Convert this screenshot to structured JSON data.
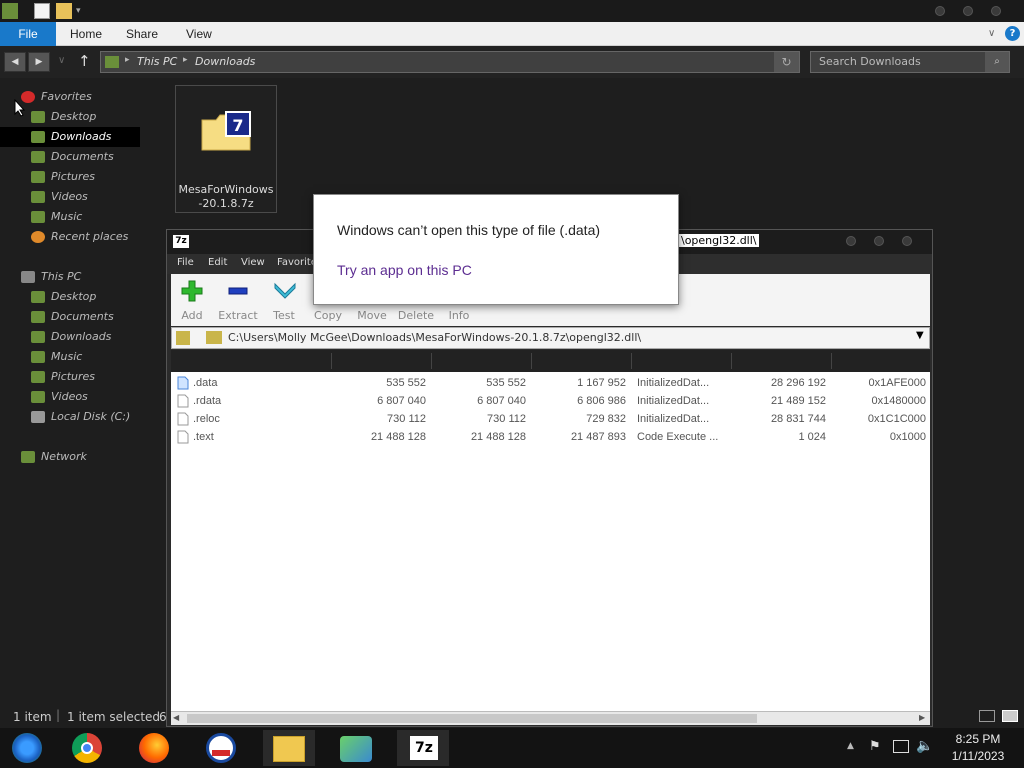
{
  "ribbon": {
    "file": "File",
    "home": "Home",
    "share": "Share",
    "view": "View"
  },
  "address": {
    "crumbs": [
      "This PC",
      "Downloads"
    ]
  },
  "search": {
    "placeholder": "Search Downloads"
  },
  "nav": {
    "favorites": "Favorites",
    "fav_items": [
      "Desktop",
      "Downloads",
      "Documents",
      "Pictures",
      "Videos",
      "Music",
      "Recent places"
    ],
    "this_pc": "This PC",
    "pc_items": [
      "Desktop",
      "Documents",
      "Downloads",
      "Music",
      "Pictures",
      "Videos",
      "Local Disk (C:)"
    ],
    "network": "Network"
  },
  "file_tile": {
    "name": "MesaForWindows-20.1.8.7z"
  },
  "sevenzip": {
    "title_suffix": "\\opengl32.dll\\",
    "menu": [
      "File",
      "Edit",
      "View",
      "Favorites"
    ],
    "toolbar": [
      "Add",
      "Extract",
      "Test",
      "Copy",
      "Move",
      "Delete",
      "Info"
    ],
    "path": "C:\\Users\\Molly McGee\\Downloads\\MesaForWindows-20.1.8.7z\\opengl32.dll\\",
    "rows": [
      {
        "name": ".data",
        "size": "535 552",
        "packed": "535 552",
        "virtual": "1 167 952",
        "chars": "InitializedDat...",
        "offset": "28 296 192",
        "va": "0x1AFE000"
      },
      {
        "name": ".rdata",
        "size": "6 807 040",
        "packed": "6 807 040",
        "virtual": "6 806 986",
        "chars": "InitializedDat...",
        "offset": "21 489 152",
        "va": "0x1480000"
      },
      {
        "name": ".reloc",
        "size": "730 112",
        "packed": "730 112",
        "virtual": "729 832",
        "chars": "InitializedDat...",
        "offset": "28 831 744",
        "va": "0x1C1C000"
      },
      {
        "name": ".text",
        "size": "21 488 128",
        "packed": "21 488 128",
        "virtual": "21 487 893",
        "chars": "Code Execute ...",
        "offset": "1 024",
        "va": "0x1000"
      }
    ]
  },
  "popup": {
    "message": "Windows can’t open this type of file (.data)",
    "link": "Try an app on this PC"
  },
  "status": {
    "count": "1 item",
    "selected": "1 item selected",
    "extra": "6"
  },
  "clock": {
    "time": "8:25 PM",
    "date": "1/11/2023"
  },
  "colors": {
    "ribbon_file": "#1979ca",
    "link": "#5c2d91",
    "green_add": "#2eb82e",
    "blue_extract": "#1f3fbf"
  }
}
